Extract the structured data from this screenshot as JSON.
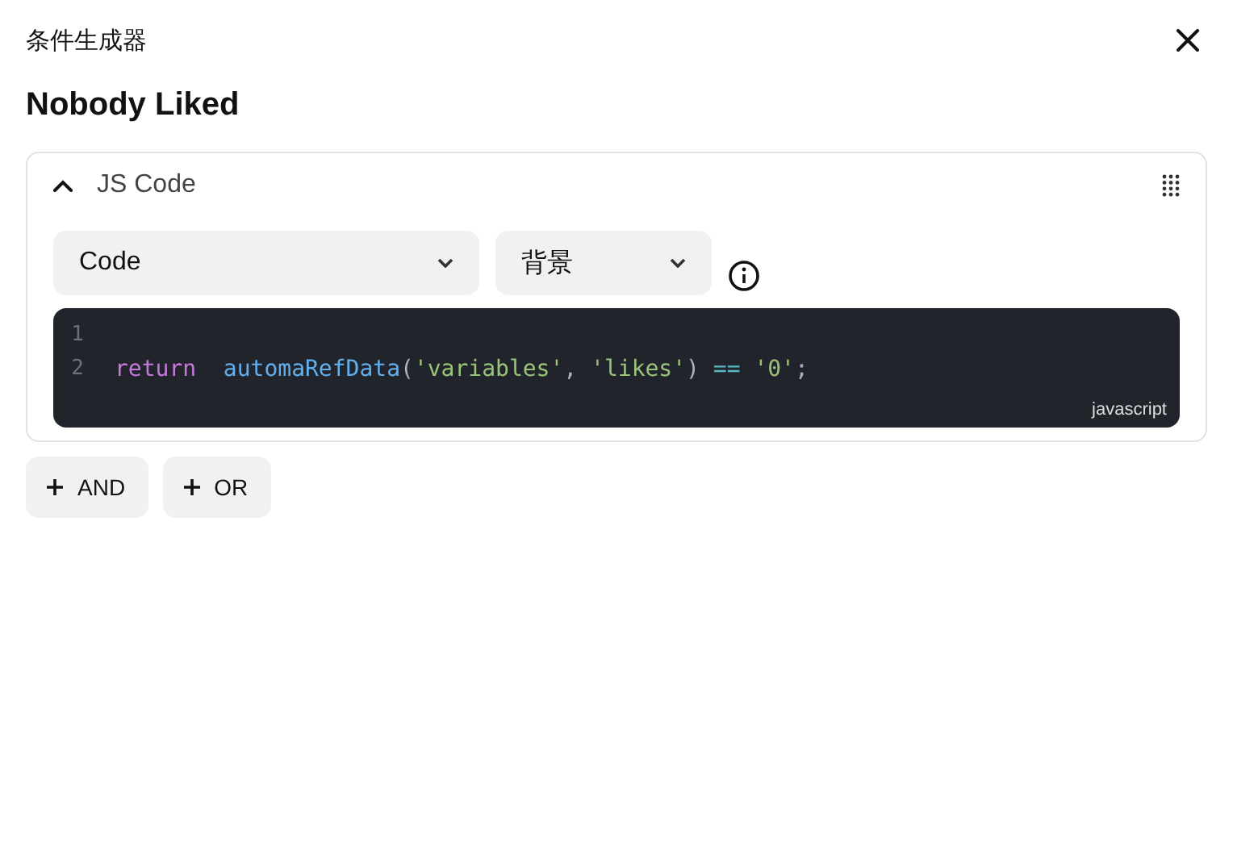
{
  "dialog": {
    "title": "条件生成器"
  },
  "heading": "Nobody Liked",
  "group": {
    "expanded": true,
    "label": "JS Code",
    "selects": [
      {
        "value": "Code"
      },
      {
        "value": "背景"
      }
    ],
    "editor": {
      "lines": [
        {
          "number": "1"
        },
        {
          "number": "2",
          "tokens": [
            {
              "kind": "keyword",
              "text": "return"
            },
            {
              "kind": "function",
              "text": "  automaRefData"
            },
            {
              "kind": "punct",
              "text": "("
            },
            {
              "kind": "string",
              "text": "'variables'"
            },
            {
              "kind": "punct",
              "text": ", "
            },
            {
              "kind": "string",
              "text": "'likes'"
            },
            {
              "kind": "punct",
              "text": ") "
            },
            {
              "kind": "operator",
              "text": "== "
            },
            {
              "kind": "string",
              "text": "'0'"
            },
            {
              "kind": "punct",
              "text": ";"
            }
          ]
        }
      ],
      "language": "javascript"
    }
  },
  "buttons": [
    {
      "label": "AND"
    },
    {
      "label": "OR"
    }
  ]
}
